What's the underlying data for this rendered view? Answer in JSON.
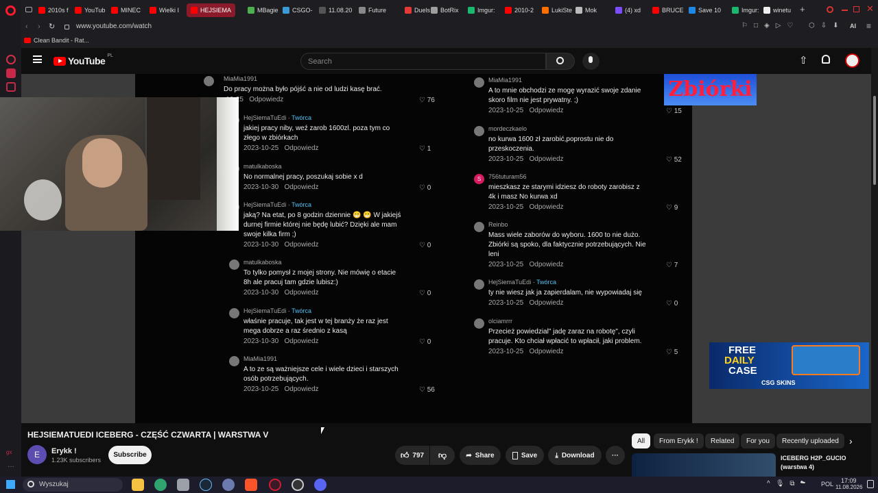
{
  "browser": {
    "tabs": [
      {
        "label": "2010s f",
        "color": "#ff0000"
      },
      {
        "label": "YouTub",
        "color": "#ff0000"
      },
      {
        "label": "MINEC",
        "color": "#ff0000"
      },
      {
        "label": "Wielki I",
        "color": "#ff0000"
      },
      {
        "label": "HEJSIEMA",
        "color": "#ff0000",
        "active": true
      },
      {
        "label": "MBagie",
        "color": "#4caf50"
      },
      {
        "label": "CSGO-",
        "color": "#3c9bd6"
      },
      {
        "label": "11.08.20",
        "color": "#555555"
      },
      {
        "label": "Future",
        "color": "#888888"
      },
      {
        "label": "Duels",
        "color": "#e53935"
      },
      {
        "label": "BotRix",
        "color": "#9e9e9e"
      },
      {
        "label": "Imgur:",
        "color": "#1bb76e"
      },
      {
        "label": "2010-2",
        "color": "#ff0000"
      },
      {
        "label": "LukiSte",
        "color": "#ff6f00"
      },
      {
        "label": "Mok",
        "color": "#bbbbbb"
      },
      {
        "label": "(4) xd",
        "color": "#7c4dff"
      },
      {
        "label": "BRUCE",
        "color": "#ff0000"
      },
      {
        "label": "Save 10",
        "color": "#1e88e5"
      },
      {
        "label": "Imgur:",
        "color": "#1bb76e"
      },
      {
        "label": "winetu",
        "color": "#eeeeee"
      }
    ],
    "url": "www.youtube.com/watch",
    "bookmark": "Clean Bandit - Rat...",
    "ai_label": "AI"
  },
  "header": {
    "logo_text": "YouTube",
    "logo_region": "PL",
    "search_placeholder": "Search"
  },
  "comments_left": [
    {
      "name": "MiaMia1991",
      "creator": false,
      "text": [
        "Do pracy można było pójść a nie od ludzi kasę brać."
      ],
      "date": "-10-25",
      "reply": "Odpowiedz",
      "likes": "76"
    },
    {
      "name": "HejSiemaTuEdi",
      "creator": true,
      "text": [
        "jakiej pracy niby, weź zarob 1600zl. poza tym co",
        "złego w zbiórkach"
      ],
      "date": "2023-10-25",
      "reply": "Odpowiedz",
      "likes": "1"
    },
    {
      "name": "matulkaboska",
      "creator": false,
      "text": [
        "No normalnej pracy, poszukaj sobie x d"
      ],
      "date": "2023-10-30",
      "reply": "Odpowiedz",
      "likes": "0"
    },
    {
      "name": "HejSiemaTuEdi",
      "creator": true,
      "text": [
        "jaką? Na etat, po 8 godzin dziennie 😁 😁  W jakiejś",
        "durnej firmie której nie będę lubić? Dzięki ale mam",
        "swoje kilka firm ;)"
      ],
      "date": "2023-10-30",
      "reply": "Odpowiedz",
      "likes": "0"
    },
    {
      "name": "matulkaboska",
      "creator": false,
      "text": [
        "To tylko pomysł z mojej strony. Nie mówię o etacie",
        "8h ale pracuj tam gdzie lubisz:)"
      ],
      "date": "2023-10-30",
      "reply": "Odpowiedz",
      "likes": "0"
    },
    {
      "name": "HejSiemaTuEdi",
      "creator": true,
      "text": [
        "właśnie pracuje, tak jest w tej branży że raz jest",
        "mega dobrze a raz średnio z kasą"
      ],
      "date": "2023-10-30",
      "reply": "Odpowiedz",
      "likes": "0"
    },
    {
      "name": "MiaMia1991",
      "creator": false,
      "text": [
        "A to ze są ważniejsze cele i wiele dzieci i starszych",
        "osób potrzebujących."
      ],
      "date": "2023-10-25",
      "reply": "Odpowiedz",
      "likes": "56"
    }
  ],
  "comments_right": [
    {
      "name": "MiaMia1991",
      "creator": false,
      "text": [
        "A to mnie obchodzi ze mogę wyrazić swoje zdanie",
        "skoro film nie jest prywatny. ;)"
      ],
      "date": "2023-10-25",
      "reply": "Odpowiedz",
      "likes": "15"
    },
    {
      "name": "mordeczkaelo",
      "creator": false,
      "text": [
        "no kurwa 1600 zł zarobić,poprostu nie do",
        "przeskoczenia."
      ],
      "date": "2023-10-25",
      "reply": "Odpowiedz",
      "likes": "52"
    },
    {
      "name": "756tuturam56",
      "creator": false,
      "text": [
        "mieszkasz ze starymi idziesz do roboty zarobisz z",
        "4k i masz No kurwa xd"
      ],
      "date": "2023-10-25",
      "reply": "Odpowiedz",
      "likes": "9",
      "avatar_letter": "S"
    },
    {
      "name": "Reinbo",
      "creator": false,
      "text": [
        "Mass wiele zaborów do wyboru. 1600 to nie dużo.",
        "Zbiórki są spoko, dla faktycznie potrzebujących. Nie",
        "leni"
      ],
      "date": "2023-10-25",
      "reply": "Odpowiedz",
      "likes": "7"
    },
    {
      "name": "HejSiemaTuEdi",
      "creator": true,
      "text": [
        "ty nie wiesz jak ja zapierdalam, nie wypowiadaj się"
      ],
      "date": "2023-10-25",
      "reply": "Odpowiedz",
      "likes": "0"
    },
    {
      "name": "olciamrrr",
      "creator": false,
      "text": [
        "Przecież powiedzial\" jadę zaraz na robotę\", czyli",
        "pracuje. Kto chciał wpłacić to wpłacił, jaki problem."
      ],
      "date": "2023-10-25",
      "reply": "Odpowiedz",
      "likes": "5"
    }
  ],
  "creator_label": "Twórca",
  "overlay": {
    "zbiorki": "Zbiórki",
    "ad_line1": "FREE",
    "ad_line2": "DAILY",
    "ad_line3": "CASE",
    "ad_brand": "CSG SKINS"
  },
  "video": {
    "title": "HEJSIEMATUEDI ICEBERG - CZĘŚĆ CZWARTA | WARSTWA V",
    "channel": "Erykk !",
    "channel_initial": "E",
    "subscribers": "1.23K subscribers",
    "subscribe": "Subscribe",
    "likes": "797",
    "share": "Share",
    "save": "Save",
    "download": "Download"
  },
  "chips": [
    "All",
    "From Erykk !",
    "Related",
    "For you",
    "Recently uploaded"
  ],
  "recommended": {
    "title_line1": "ICEBERG H2P_GUCIO",
    "title_line2": "(warstwa 4)"
  },
  "taskbar": {
    "search": "Wyszukaj",
    "lang": "POL",
    "time": "17:09",
    "date": "11.08.2026"
  }
}
